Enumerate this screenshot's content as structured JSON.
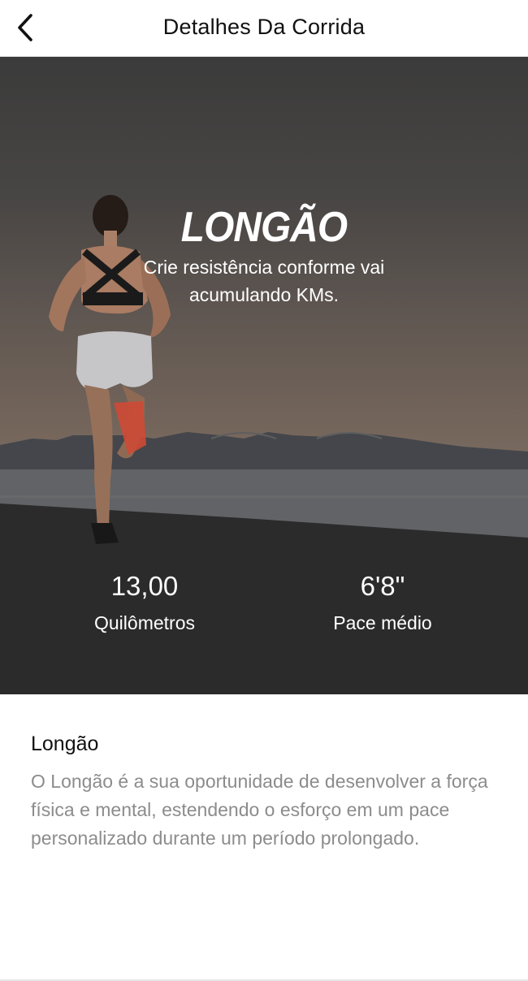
{
  "header": {
    "back_icon": "chevron-left-icon",
    "title": "Detalhes Da Corrida"
  },
  "hero": {
    "title": "LONGÃO",
    "subtitle": "Crie resistência conforme vai acumulando KMs."
  },
  "stats": [
    {
      "value": "13,00",
      "label": "Quilômetros"
    },
    {
      "value": "6'8\"",
      "label": "Pace médio"
    }
  ],
  "description": {
    "title": "Longão",
    "body": "O Longão é a sua oportunidade de desenvolver a força física e mental, estendendo o esforço em um pace personalizado durante um período prolongado."
  }
}
